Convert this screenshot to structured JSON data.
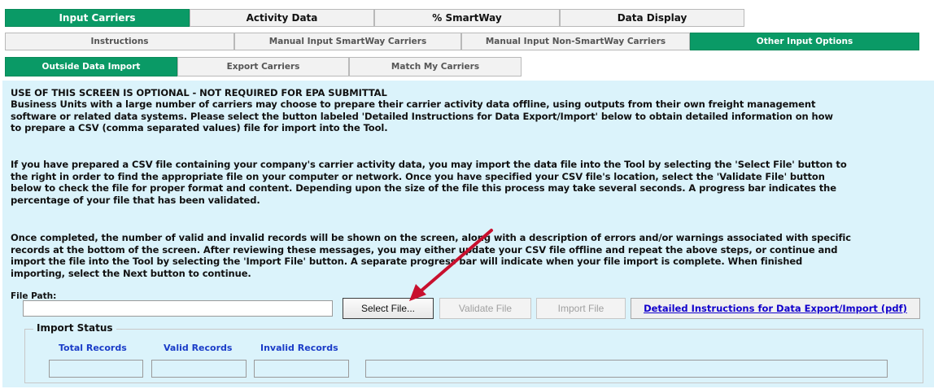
{
  "tabs_row1": [
    {
      "label": "Input Carriers",
      "active": true
    },
    {
      "label": "Activity Data",
      "active": false
    },
    {
      "label": "% SmartWay",
      "active": false
    },
    {
      "label": "Data Display",
      "active": false
    }
  ],
  "tabs_row2": [
    {
      "label": "Instructions",
      "active": false
    },
    {
      "label": "Manual Input SmartWay Carriers",
      "active": false
    },
    {
      "label": "Manual Input Non-SmartWay Carriers",
      "active": false
    },
    {
      "label": "Other Input Options",
      "active": true
    }
  ],
  "tabs_row3": [
    {
      "label": "Outside Data Import",
      "active": true
    },
    {
      "label": "Export Carriers",
      "active": false
    },
    {
      "label": "Match My Carriers",
      "active": false
    }
  ],
  "content": {
    "heading": "USE OF THIS SCREEN IS OPTIONAL - NOT REQUIRED FOR EPA SUBMITTAL",
    "para1": [
      "Business Units with a large number of carriers may choose to prepare their carrier activity data offline, using outputs from their own freight management",
      "software or related data systems.  Please select the button labeled 'Detailed Instructions for Data Export/Import' below to obtain detailed information on how",
      "to prepare a CSV (comma separated values) file for import into the Tool."
    ],
    "para2": [
      "If you have prepared a CSV file containing your company's carrier activity data, you may import the data file into the Tool by selecting the 'Select File' button to",
      "the right in order to find the appropriate file on your computer or network. Once you have specified your CSV file's location, select the 'Validate File' button",
      "below to check the file for proper format and content.  Depending upon the size of the file this process may take several seconds.  A progress bar indicates the",
      "percentage of your file that has been validated."
    ],
    "para3": [
      "Once completed, the number of valid and invalid records will be shown on the screen, along with a description of errors and/or warnings associated with specific",
      "records at the bottom of the screen.  After reviewing these messages, you may either update your CSV file offline and repeat the above steps, or continue and",
      "import the file into the Tool by selecting the 'Import File' button. A separate progress bar will indicate when your file import is complete. When finished",
      "importing, select the Next button to continue."
    ]
  },
  "file": {
    "label": "File Path:",
    "value": "",
    "select_button": "Select File...",
    "validate_button": "Validate File",
    "import_button": "Import File",
    "instructions_link": "Detailed Instructions for Data Export/Import (pdf)"
  },
  "import_status": {
    "title": "Import Status",
    "total_label": "Total Records",
    "valid_label": "Valid Records",
    "invalid_label": "Invalid Records",
    "total_value": "",
    "valid_value": "",
    "invalid_value": "",
    "progress": 0
  },
  "colors": {
    "active_tab": "#0a9a66",
    "panel_bg": "#dbf3fb",
    "link": "#1100cc",
    "status_label": "#1a3cc8",
    "arrow": "#c8102e"
  }
}
